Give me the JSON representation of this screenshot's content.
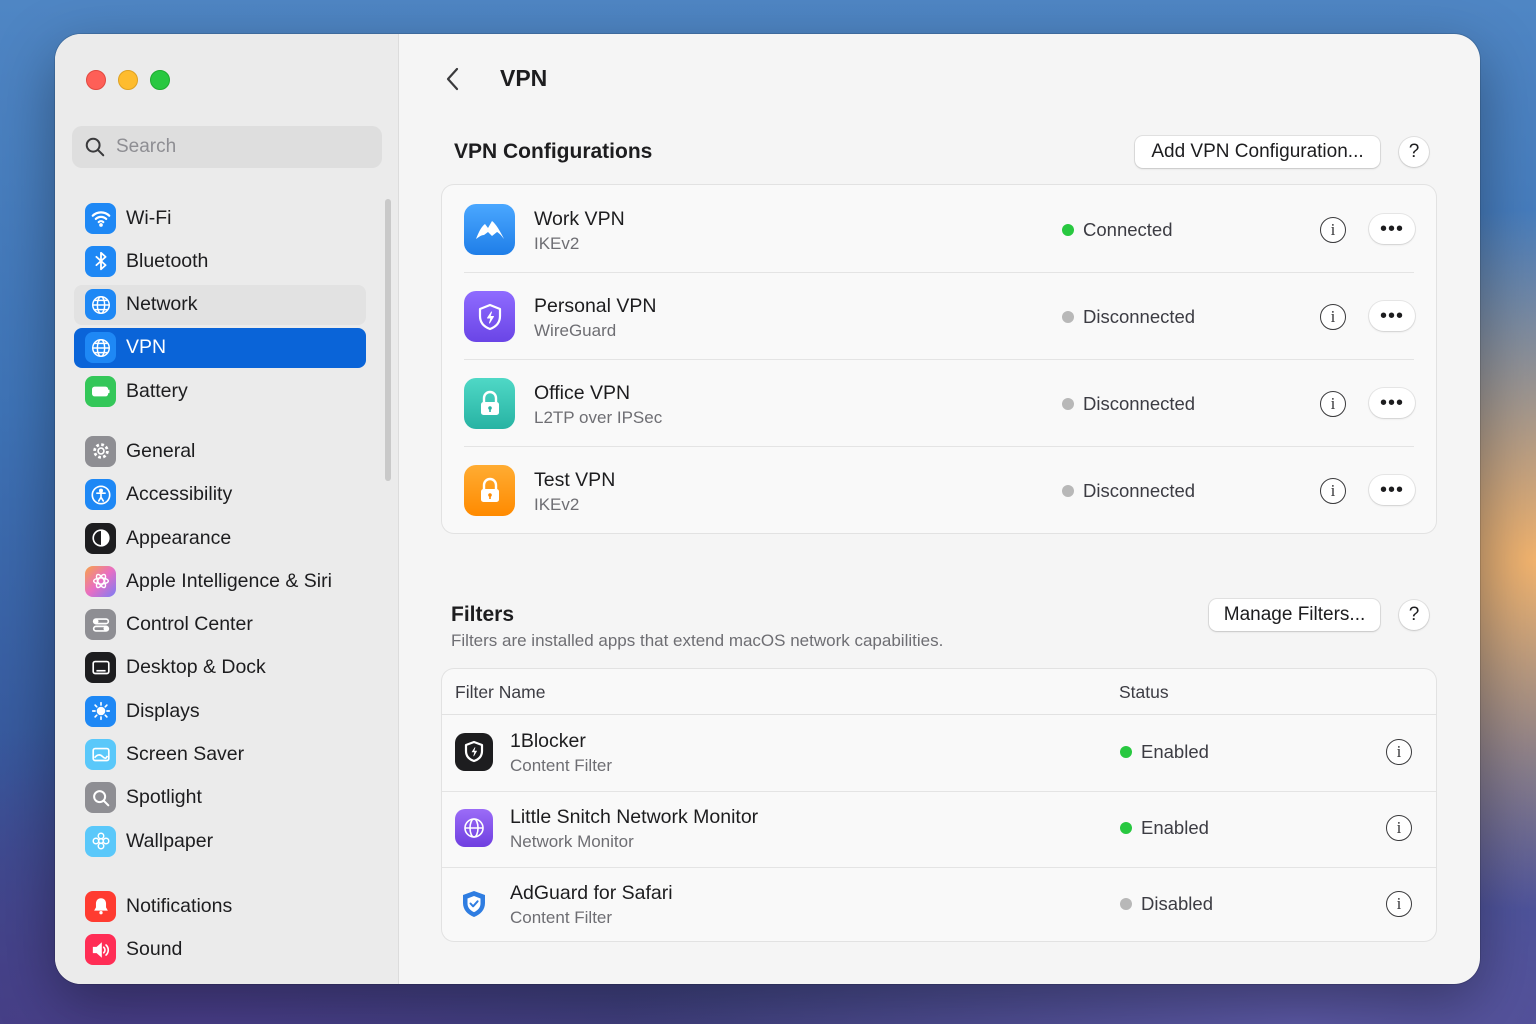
{
  "sidebar": {
    "search_placeholder": "Search",
    "items": [
      {
        "label": "Wi-Fi",
        "icon": "wifi-icon",
        "color": "#1e88f5"
      },
      {
        "label": "Bluetooth",
        "icon": "bluetooth-icon",
        "color": "#1e88f5"
      },
      {
        "label": "Network",
        "icon": "globe-icon",
        "color": "#1e88f5"
      },
      {
        "label": "VPN",
        "icon": "globe-icon",
        "color": "#1e88f5"
      },
      {
        "label": "Battery",
        "icon": "battery-icon",
        "color": "#34c759"
      },
      {
        "label": "General",
        "icon": "gear-icon",
        "color": "#8e8e93"
      },
      {
        "label": "Accessibility",
        "icon": "accessibility-icon",
        "color": "#1e88f5"
      },
      {
        "label": "Appearance",
        "icon": "appearance-icon",
        "color": "#1d1d1f"
      },
      {
        "label": "Apple Intelligence & Siri",
        "icon": "siri-icon",
        "color": "#e98bd0"
      },
      {
        "label": "Control Center",
        "icon": "control-center-icon",
        "color": "#8e8e93"
      },
      {
        "label": "Desktop & Dock",
        "icon": "desktop-dock-icon",
        "color": "#1d1d1f"
      },
      {
        "label": "Displays",
        "icon": "displays-icon",
        "color": "#1e88f5"
      },
      {
        "label": "Screen Saver",
        "icon": "screen-saver-icon",
        "color": "#5ac8fa"
      },
      {
        "label": "Spotlight",
        "icon": "spotlight-icon",
        "color": "#8e8e93"
      },
      {
        "label": "Wallpaper",
        "icon": "wallpaper-icon",
        "color": "#5ac8fa"
      },
      {
        "label": "Notifications",
        "icon": "notifications-icon",
        "color": "#ff3b30"
      },
      {
        "label": "Sound",
        "icon": "sound-icon",
        "color": "#ff2d55"
      }
    ],
    "active": "VPN",
    "hover": "Network"
  },
  "header": {
    "title": "VPN"
  },
  "vpn_section": {
    "title": "VPN Configurations",
    "add_button": "Add VPN Configuration...",
    "help": "?",
    "configs": [
      {
        "name": "Work VPN",
        "type": "IKEv2",
        "status": "Connected",
        "status_color": "#28c840",
        "icon": "mountain-icon",
        "icon_color": "#2f8cf5"
      },
      {
        "name": "Personal VPN",
        "type": "WireGuard",
        "status": "Disconnected",
        "status_color": "#b8b8b8",
        "icon": "shield-icon",
        "icon_color": "#7b5cf0"
      },
      {
        "name": "Office VPN",
        "type": "L2TP over IPSec",
        "status": "Disconnected",
        "status_color": "#b8b8b8",
        "icon": "lock-icon",
        "icon_color": "#36c4b4"
      },
      {
        "name": "Test VPN",
        "type": "IKEv2",
        "status": "Disconnected",
        "status_color": "#b8b8b8",
        "icon": "lock-icon",
        "icon_color": "#ff9500"
      }
    ]
  },
  "filters_section": {
    "title": "Filters",
    "description": "Filters are installed apps that extend macOS network capabilities.",
    "manage_button": "Manage Filters...",
    "help": "?",
    "columns": [
      "Filter Name",
      "Status"
    ],
    "rows": [
      {
        "name": "1Blocker",
        "kind": "Content Filter",
        "status": "Enabled",
        "status_color": "#28c840",
        "icon": "1blocker-shield-icon"
      },
      {
        "name": "Little Snitch Network Monitor",
        "kind": "Network Monitor",
        "status": "Enabled",
        "status_color": "#28c840",
        "icon": "globe-icon"
      },
      {
        "name": "AdGuard for Safari",
        "kind": "Content Filter",
        "status": "Disabled",
        "status_color": "#b8b8b8",
        "icon": "adguard-shield-icon"
      }
    ]
  }
}
